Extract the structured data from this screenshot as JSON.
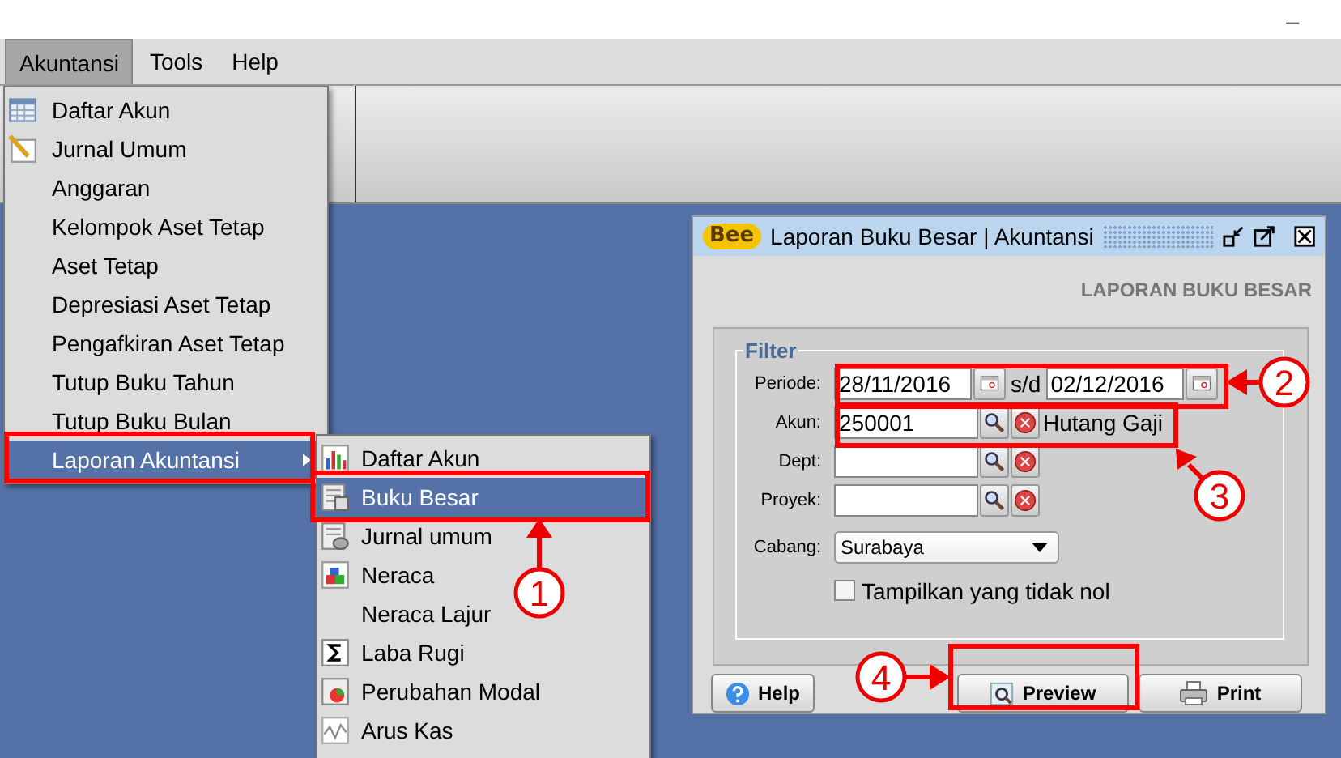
{
  "window_controls": [
    {
      "label": "_"
    }
  ],
  "menubar": [
    {
      "label": "Akuntansi",
      "selected": true
    },
    {
      "label": "Tools",
      "selected": false
    },
    {
      "label": "Help",
      "selected": false
    }
  ],
  "menu": {
    "items": [
      {
        "label": "Daftar Akun",
        "kind": "table",
        "selected": false
      },
      {
        "label": "Jurnal Umum",
        "kind": "pencil",
        "selected": false
      },
      {
        "label": "Anggaran",
        "kind": "plain",
        "selected": false
      },
      {
        "label": "Kelompok Aset Tetap",
        "kind": "plain",
        "selected": false
      },
      {
        "label": "Aset Tetap",
        "kind": "plain",
        "selected": false
      },
      {
        "label": "Depresiasi Aset Tetap",
        "kind": "plain",
        "selected": false
      },
      {
        "label": "Pengafkiran Aset Tetap",
        "kind": "plain",
        "selected": false
      },
      {
        "label": "Tutup Buku Tahun",
        "kind": "plain",
        "selected": false
      },
      {
        "label": "Tutup Buku Bulan",
        "kind": "plain",
        "selected": false
      },
      {
        "label": "Laporan Akuntansi",
        "kind": "submenu",
        "selected": true
      }
    ]
  },
  "submenu": {
    "items": [
      {
        "label": "Daftar Akun",
        "kind": "barchart",
        "selected": false
      },
      {
        "label": "Buku Besar",
        "kind": "ledger",
        "selected": true
      },
      {
        "label": "Jurnal umum",
        "kind": "database",
        "selected": false
      },
      {
        "label": "Neraca",
        "kind": "blocks",
        "selected": false
      },
      {
        "label": "Neraca Lajur",
        "kind": "plain",
        "selected": false
      },
      {
        "label": "Laba Rugi",
        "kind": "sigma",
        "selected": false
      },
      {
        "label": "Perubahan Modal",
        "kind": "piechart",
        "selected": false
      },
      {
        "label": "Arus Kas",
        "kind": "linechart",
        "selected": false
      }
    ]
  },
  "dialog": {
    "logo": "Bee",
    "title": "Laporan Buku Besar | Akuntansi",
    "heading": "LAPORAN BUKU BESAR",
    "filter": {
      "legend": "Filter",
      "periode": {
        "label": "Periode:",
        "from": "28/11/2016",
        "separator": "s/d",
        "to": "02/12/2016"
      },
      "akun": {
        "label": "Akun:",
        "value": "250001",
        "name": "Hutang Gaji"
      },
      "dept": {
        "label": "Dept:"
      },
      "proyek": {
        "label": "Proyek:"
      },
      "cabang": {
        "label": "Cabang:",
        "value": "Surabaya"
      },
      "nonzero": {
        "label": "Tampilkan yang tidak nol",
        "checked": false
      }
    },
    "buttons": [
      {
        "label": "Help",
        "kind": "help"
      },
      {
        "label": "Preview",
        "kind": "preview"
      },
      {
        "label": "Print",
        "kind": "print"
      }
    ]
  },
  "annotations": [
    {
      "number": "1"
    },
    {
      "number": "2"
    },
    {
      "number": "3"
    },
    {
      "number": "4"
    }
  ]
}
